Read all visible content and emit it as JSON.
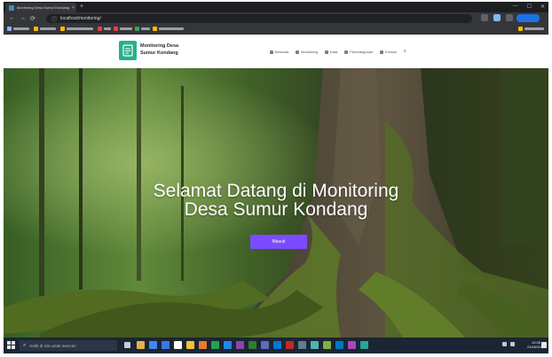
{
  "browser": {
    "tab_title": "Monitoring Desa Sumur Kondang",
    "close_glyph": "×",
    "new_tab_glyph": "+",
    "url": "localhost/monitoring/",
    "window_controls": [
      "—",
      "☐",
      "✕"
    ],
    "nav_glyphs": {
      "back": "←",
      "forward": "→",
      "reload": "⟳"
    },
    "lock_glyph": "ⓘ"
  },
  "site": {
    "logo_icon": "document-leaf-icon",
    "logo_line1": "Monitoring Desa",
    "logo_line2": "Sumur Kondang",
    "nav": [
      "Beranda",
      "Monitoring",
      "Data",
      "Pembangunan",
      "Kontak"
    ],
    "search_glyph": "⌕"
  },
  "hero": {
    "title_line1": "Selamat Datang di Monitoring",
    "title_line2": "Desa Sumur Kondang",
    "cta_label": "Masuk"
  },
  "taskbar": {
    "search_placeholder": "Ketik di sini untuk mencari",
    "search_glyph": "⌕",
    "clock_time": "10:45",
    "clock_date": "21/06/2021"
  },
  "colors": {
    "accent": "#7b4cff",
    "logo": "#28b08a",
    "chrome_dark": "#202124",
    "taskbar": "#1b2533"
  }
}
